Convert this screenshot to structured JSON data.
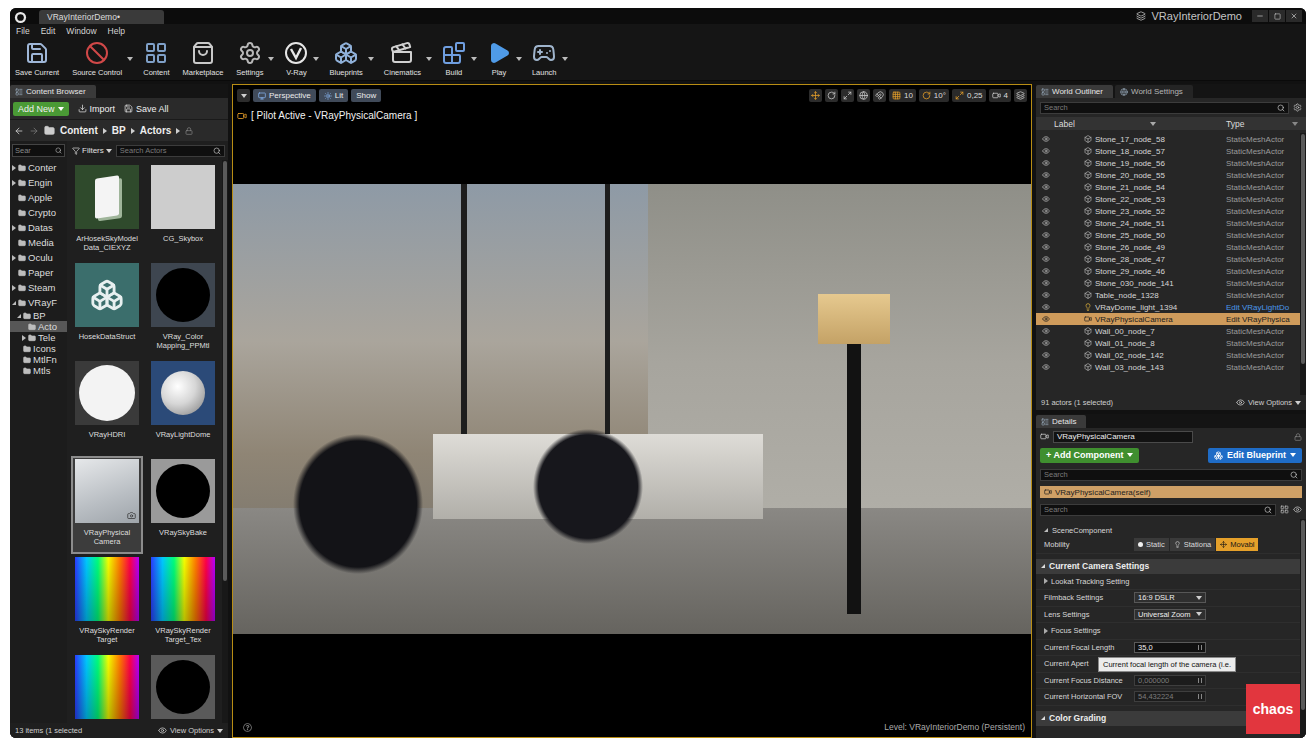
{
  "window": {
    "tab": "VRayInteriorDemo•",
    "title": "VRayInteriorDemo"
  },
  "menu": [
    "File",
    "Edit",
    "Window",
    "Help"
  ],
  "toolbar": [
    {
      "label": "Save Current",
      "kind": "save",
      "dropdown": false
    },
    {
      "label": "Source Control",
      "kind": "source",
      "dropdown": true
    },
    {
      "label": "Content",
      "kind": "content",
      "dropdown": false
    },
    {
      "label": "Marketplace",
      "kind": "market",
      "dropdown": false
    },
    {
      "label": "Settings",
      "kind": "settings",
      "dropdown": true
    },
    {
      "label": "V-Ray",
      "kind": "vray",
      "dropdown": true
    },
    {
      "label": "Blueprints",
      "kind": "blueprints",
      "dropdown": true
    },
    {
      "label": "Cinematics",
      "kind": "cinematics",
      "dropdown": true
    },
    {
      "label": "Build",
      "kind": "build",
      "dropdown": true
    },
    {
      "label": "Play",
      "kind": "play",
      "dropdown": true
    },
    {
      "label": "Launch",
      "kind": "launch",
      "dropdown": true
    }
  ],
  "content_browser": {
    "tab": "Content Browser",
    "buttons": [
      {
        "label": "Add New",
        "kind": "primary"
      },
      {
        "label": "Import",
        "kind": "import"
      },
      {
        "label": "Save All",
        "kind": "save"
      }
    ],
    "path": [
      "Content",
      "BP",
      "Actors"
    ],
    "tree_search": "Sear",
    "filters": "Filters",
    "search_placeholder": "Search Actors",
    "tree": [
      {
        "label": "Conter",
        "depth": 0,
        "arrow": "collapsed",
        "selected": false
      },
      {
        "label": "Engin",
        "depth": 0,
        "arrow": "collapsed",
        "selected": false
      },
      {
        "label": "Apple",
        "depth": 0,
        "arrow": "none",
        "selected": false
      },
      {
        "label": "Crypto",
        "depth": 0,
        "arrow": "none",
        "selected": false
      },
      {
        "label": "Datas",
        "depth": 0,
        "arrow": "collapsed",
        "selected": false
      },
      {
        "label": "Media",
        "depth": 0,
        "arrow": "none",
        "selected": false
      },
      {
        "label": "Oculu",
        "depth": 0,
        "arrow": "collapsed",
        "selected": false
      },
      {
        "label": "Paper",
        "depth": 0,
        "arrow": "none",
        "selected": false
      },
      {
        "label": "Steam",
        "depth": 0,
        "arrow": "collapsed",
        "selected": false
      },
      {
        "label": "VRayF",
        "depth": 0,
        "arrow": "expanded",
        "selected": false
      },
      {
        "label": "BP",
        "depth": 1,
        "arrow": "expanded",
        "selected": false
      },
      {
        "label": "Acto",
        "depth": 2,
        "arrow": "none",
        "selected": true
      },
      {
        "label": "Tele",
        "depth": 2,
        "arrow": "collapsed",
        "selected": false
      },
      {
        "label": "Icons",
        "depth": 1,
        "arrow": "none",
        "selected": false
      },
      {
        "label": "MtlFn",
        "depth": 1,
        "arrow": "none",
        "selected": false
      },
      {
        "label": "Mtls",
        "depth": 1,
        "arrow": "none",
        "selected": false
      }
    ],
    "assets": [
      {
        "lines": [
          "ArHosekSkyModel",
          "Data_CIEXYZ"
        ],
        "kind": "card",
        "color": "#2f4a2c",
        "selected": false
      },
      {
        "lines": [
          "CG_Skybox"
        ],
        "kind": "plain",
        "color": "#cdcdcd",
        "selected": false
      },
      {
        "lines": [
          "HosekDataStruct"
        ],
        "kind": "struct",
        "color": "#3b6e6c",
        "selected": false
      },
      {
        "lines": [
          "VRay_Color",
          "Mapping_PPMtl"
        ],
        "kind": "black-circle",
        "color": "#3e4650",
        "selected": false
      },
      {
        "lines": [
          "VRayHDRI"
        ],
        "kind": "white-circle",
        "color": "#3a3a3a",
        "selected": false
      },
      {
        "lines": [
          "VRayLightDome"
        ],
        "kind": "sphere",
        "color": "#2b4a78",
        "selected": false
      },
      {
        "lines": [
          "VRayPhysical",
          "Camera"
        ],
        "kind": "camera",
        "color": "#c9cdd1",
        "selected": true
      },
      {
        "lines": [
          "VRaySkyBake"
        ],
        "kind": "black-circle",
        "color": "#9a9a9a",
        "selected": false
      },
      {
        "lines": [
          "VRaySkyRender",
          "Target"
        ],
        "kind": "rainbow",
        "color": "#3a3a3a",
        "selected": false
      },
      {
        "lines": [
          "VRaySkyRender",
          "Target_Tex"
        ],
        "kind": "rainbow",
        "color": "#3a3a3a",
        "selected": false
      },
      {
        "lines": [],
        "kind": "rainbow",
        "color": "#3a3a3a",
        "selected": false
      },
      {
        "lines": [],
        "kind": "black-circle",
        "color": "#5a5a5a",
        "selected": false
      }
    ],
    "status": "13 items (1 selected",
    "view_options": "View Options"
  },
  "viewport": {
    "buttons": [
      {
        "label": "Perspective",
        "kind": "perspective"
      },
      {
        "label": "Lit",
        "kind": "lit"
      },
      {
        "label": "Show",
        "kind": "show"
      }
    ],
    "snaps": [
      {
        "kind": "grid",
        "value": "10",
        "on": true
      },
      {
        "kind": "rotate",
        "value": "10°",
        "on": true
      },
      {
        "kind": "scale",
        "value": "0,25",
        "on": true
      },
      {
        "kind": "camera",
        "value": "4",
        "on": false
      }
    ],
    "pilot": "[ Pilot Active - VRayPhysicalCamera ]",
    "level": "Level:  VRayInteriorDemo (Persistent)"
  },
  "outliner": {
    "tabs": [
      {
        "label": "World Outliner",
        "selected": true
      },
      {
        "label": "World Settings",
        "selected": false
      }
    ],
    "search_placeholder": "Search",
    "columns": [
      "Label",
      "Type"
    ],
    "rows": [
      {
        "label": "Stone_17_node_58",
        "type": "StaticMeshActor",
        "kind": "mesh",
        "link": false,
        "selected": false
      },
      {
        "label": "Stone_18_node_57",
        "type": "StaticMeshActor",
        "kind": "mesh",
        "link": false,
        "selected": false
      },
      {
        "label": "Stone_19_node_56",
        "type": "StaticMeshActor",
        "kind": "mesh",
        "link": false,
        "selected": false
      },
      {
        "label": "Stone_20_node_55",
        "type": "StaticMeshActor",
        "kind": "mesh",
        "link": false,
        "selected": false
      },
      {
        "label": "Stone_21_node_54",
        "type": "StaticMeshActor",
        "kind": "mesh",
        "link": false,
        "selected": false
      },
      {
        "label": "Stone_22_node_53",
        "type": "StaticMeshActor",
        "kind": "mesh",
        "link": false,
        "selected": false
      },
      {
        "label": "Stone_23_node_52",
        "type": "StaticMeshActor",
        "kind": "mesh",
        "link": false,
        "selected": false
      },
      {
        "label": "Stone_24_node_51",
        "type": "StaticMeshActor",
        "kind": "mesh",
        "link": false,
        "selected": false
      },
      {
        "label": "Stone_25_node_50",
        "type": "StaticMeshActor",
        "kind": "mesh",
        "link": false,
        "selected": false
      },
      {
        "label": "Stone_26_node_49",
        "type": "StaticMeshActor",
        "kind": "mesh",
        "link": false,
        "selected": false
      },
      {
        "label": "Stone_28_node_47",
        "type": "StaticMeshActor",
        "kind": "mesh",
        "link": false,
        "selected": false
      },
      {
        "label": "Stone_29_node_46",
        "type": "StaticMeshActor",
        "kind": "mesh",
        "link": false,
        "selected": false
      },
      {
        "label": "Stone_030_node_141",
        "type": "StaticMeshActor",
        "kind": "mesh",
        "link": false,
        "selected": false
      },
      {
        "label": "Table_node_1328",
        "type": "StaticMeshActor",
        "kind": "mesh",
        "link": false,
        "selected": false
      },
      {
        "label": "VRayDome_light_1394",
        "type": "Edit VRayLightDo",
        "kind": "light",
        "link": true,
        "selected": false
      },
      {
        "label": "VRayPhysicalCamera",
        "type": "Edit VRayPhysica",
        "kind": "camera",
        "link": true,
        "selected": true
      },
      {
        "label": "Wall_00_node_7",
        "type": "StaticMeshActor",
        "kind": "mesh",
        "link": false,
        "selected": false
      },
      {
        "label": "Wall_01_node_8",
        "type": "StaticMeshActor",
        "kind": "mesh",
        "link": false,
        "selected": false
      },
      {
        "label": "Wall_02_node_142",
        "type": "StaticMeshActor",
        "kind": "mesh",
        "link": false,
        "selected": false
      },
      {
        "label": "Wall_03_node_143",
        "type": "StaticMeshActor",
        "kind": "mesh",
        "link": false,
        "selected": false
      }
    ],
    "status": "91 actors (1 selected)",
    "view_options": "View Options"
  },
  "details": {
    "tab": "Details",
    "name": "VRayPhysicalCamera",
    "add_component": "+ Add Component",
    "edit_blueprint": "Edit Blueprint",
    "search_placeholder": "Search",
    "component": "VRayPhysicalCamera(self)",
    "search2_placeholder": "Search",
    "scene_component": "SceneComponent",
    "mobility": {
      "label": "Mobility",
      "options": [
        {
          "label": "Static",
          "selected": false
        },
        {
          "label": "Stationa",
          "selected": false
        },
        {
          "label": "Movabl",
          "selected": true
        }
      ]
    },
    "section": "Current Camera Settings",
    "rows": [
      {
        "label": "Lookat Tracking Setting",
        "kind": "group",
        "value": "",
        "disabled": false
      },
      {
        "label": "Filmback Settings",
        "kind": "select",
        "value": "16:9 DSLR",
        "disabled": false
      },
      {
        "label": "Lens Settings",
        "kind": "select",
        "value": "Universal Zoom",
        "disabled": false
      },
      {
        "label": "Focus Settings",
        "kind": "group",
        "value": "",
        "disabled": false
      },
      {
        "label": "Current Focal Length",
        "kind": "number",
        "value": "35,0",
        "disabled": false
      },
      {
        "label": "Current Apert",
        "kind": "covered",
        "value": "",
        "disabled": false
      },
      {
        "label": "Current Focus Distance",
        "kind": "number",
        "value": "0,000000",
        "disabled": true
      },
      {
        "label": "Current Horizontal FOV",
        "kind": "number",
        "value": "54,432224",
        "disabled": true
      }
    ],
    "section2": "Color Grading"
  },
  "tooltip": "Current focal length of the camera (i.e.",
  "watermark": "chaos"
}
